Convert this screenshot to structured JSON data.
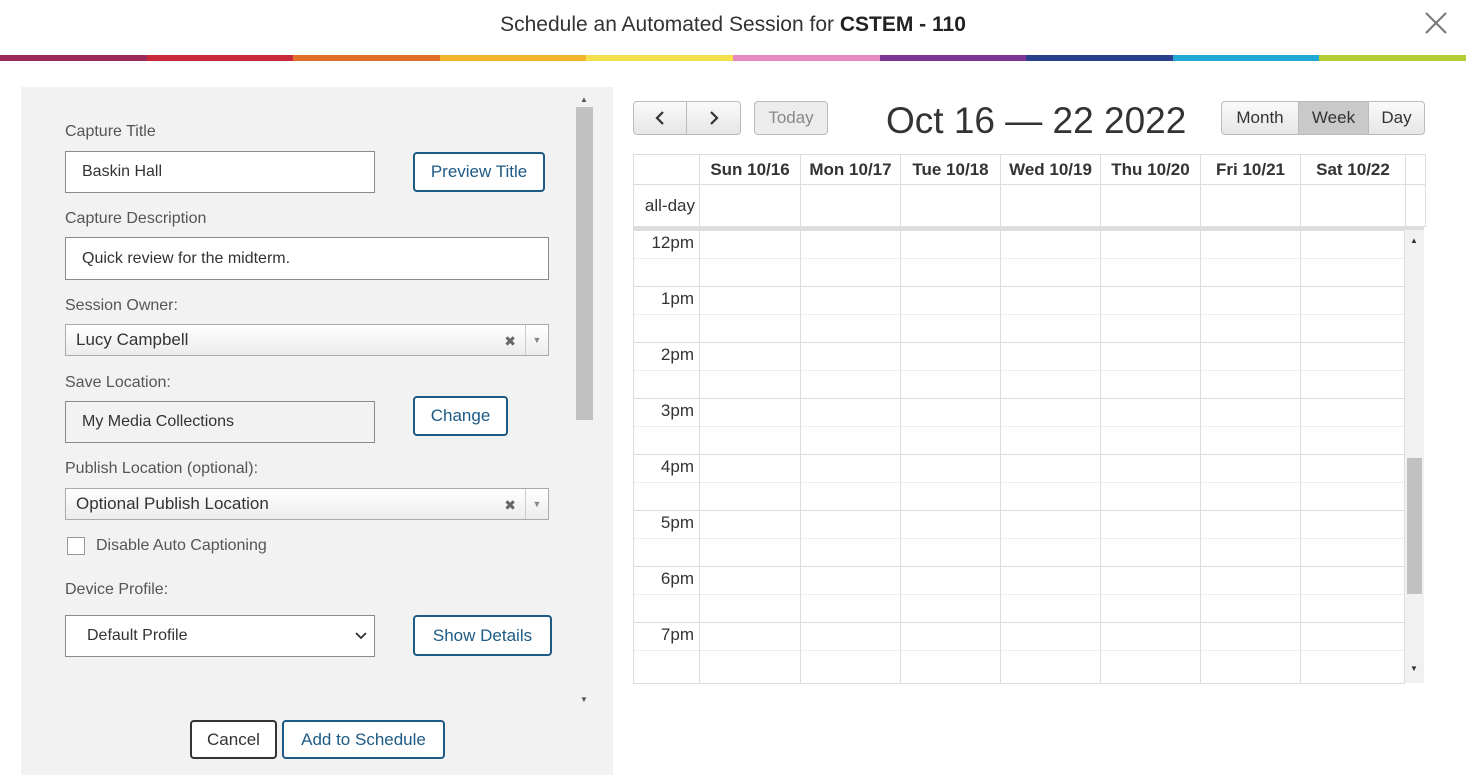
{
  "header": {
    "title_prefix": "Schedule an Automated Session for ",
    "title_course": "CSTEM - 110"
  },
  "rainbow": [
    "#9b2a5a",
    "#c8283a",
    "#e36d2b",
    "#f2b52c",
    "#f4e04a",
    "#e68bc2",
    "#7b3594",
    "#2a3f8b",
    "#21a7d4",
    "#b6cd34"
  ],
  "form": {
    "capture_title_label": "Capture Title",
    "capture_title_value": "Baskin Hall",
    "preview_title_button": "Preview Title",
    "capture_description_label": "Capture Description",
    "capture_description_value": "Quick review for the midterm.",
    "session_owner_label": "Session Owner:",
    "session_owner_value": "Lucy Campbell",
    "save_location_label": "Save Location:",
    "save_location_value": "My Media Collections",
    "change_button": "Change",
    "publish_location_label": "Publish Location (optional):",
    "publish_location_value": "Optional Publish Location",
    "disable_captioning_label": "Disable Auto Captioning",
    "device_profile_label": "Device Profile:",
    "device_profile_value": "Default Profile",
    "show_details_button": "Show Details",
    "cancel_button": "Cancel",
    "add_button": "Add to Schedule"
  },
  "calendar": {
    "today_button": "Today",
    "range_title": "Oct 16 — 22 2022",
    "views": [
      "Month",
      "Week",
      "Day"
    ],
    "active_view": "Week",
    "all_day_label": "all-day",
    "days": [
      "Sun 10/16",
      "Mon 10/17",
      "Tue 10/18",
      "Wed 10/19",
      "Thu 10/20",
      "Fri 10/21",
      "Sat 10/22"
    ],
    "hours": [
      "12pm",
      "1pm",
      "2pm",
      "3pm",
      "4pm",
      "5pm",
      "6pm",
      "7pm"
    ]
  }
}
